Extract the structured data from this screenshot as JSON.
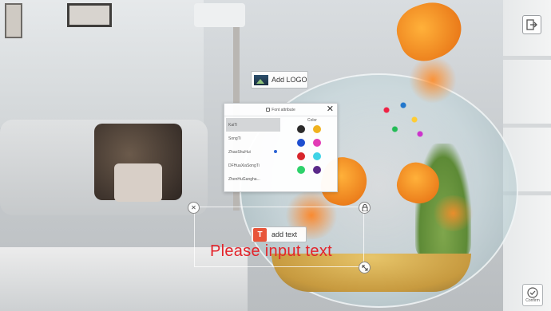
{
  "toolbar": {
    "exit_icon": "exit-icon",
    "add_logo_label": "Add LOGO",
    "confirm_label": "Confirm"
  },
  "font_panel": {
    "title": "Font attribute",
    "color_label": "Color",
    "fonts": [
      {
        "label": "KaiTi",
        "selected": true
      },
      {
        "label": "SongTi",
        "selected": false
      },
      {
        "label": "ZhaoShuHui",
        "selected": false
      },
      {
        "label": "DFHuaXiaSongTi",
        "selected": false
      },
      {
        "label": "ZhenHuGangha...",
        "selected": false
      }
    ],
    "colors": [
      "#2b2b2b",
      "#f0b21f",
      "#1f4fd0",
      "#e23bb5",
      "#d8262c",
      "#3fd3e6",
      "#2ed26b",
      "#5a2a8a"
    ]
  },
  "text_tool": {
    "add_text_label": "add text",
    "input_text": "Please input text",
    "text_color": "#e3242b"
  }
}
